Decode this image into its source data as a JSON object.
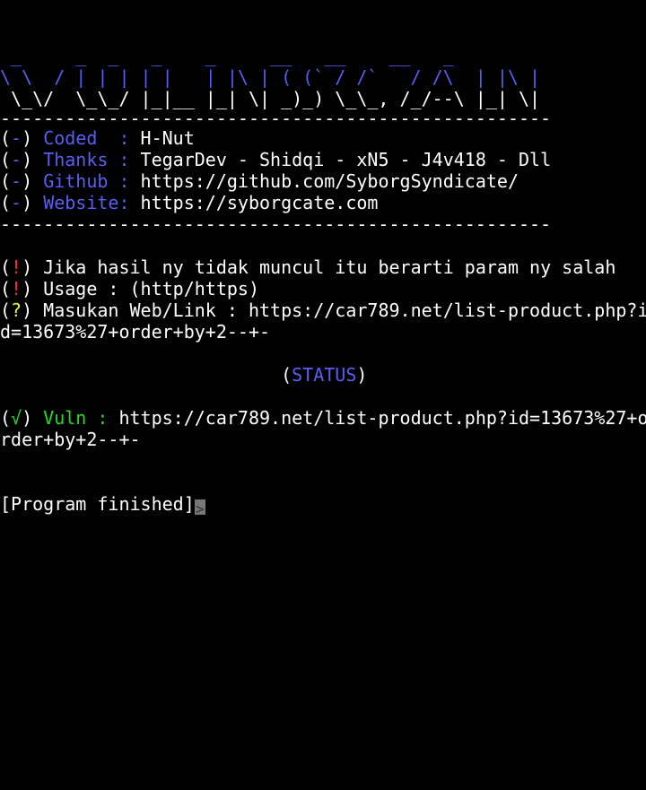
{
  "banner": {
    "lines": [
      " _     _  _   _    _     __   __    __   _  ",
      "\\ \\  / | | | | |   | |\\ | ( (` / /`   / /\\  | |\\ |",
      " \\_\\/  \\_\\_/ |_|__ |_| \\| _)_) \\_\\_, /_/--\\ |_| \\|"
    ],
    "color": "#5a5ef2"
  },
  "separator": "---------------------------------------------------",
  "info": {
    "items": [
      {
        "bullet": "-",
        "label": "Coded  :",
        "value": " H-Nut"
      },
      {
        "bullet": "-",
        "label": "Thanks :",
        "value": " TegarDev - Shidqi - xN5 - J4v418 - Dll"
      },
      {
        "bullet": "-",
        "label": "Github :",
        "value": " https://github.com/SyborgSyndicate/"
      },
      {
        "bullet": "-",
        "label": "Website:",
        "value": " https://syborgcate.com"
      }
    ]
  },
  "messages": {
    "warning_1": {
      "symbol": "!",
      "text": " Jika hasil ny tidak muncul itu berarti param ny salah"
    },
    "warning_2": {
      "symbol": "!",
      "text": " Usage : (http/https)"
    },
    "prompt": {
      "symbol": "?",
      "text": " Masukan Web/Link : https://car789.net/list-product.php?i",
      "wrap": "d=13673%27+order+by+2--+-"
    }
  },
  "status": {
    "indent": "                          ",
    "open": "(",
    "label": "STATUS",
    "close": ")"
  },
  "result": {
    "symbol": "√",
    "label": " Vuln :",
    "value": " https://car789.net/list-product.php?id=13673%27+o",
    "wrap": "rder+by+2--+-"
  },
  "footer": {
    "text": "[Program finished]",
    "cursor": ">"
  },
  "colors": {
    "background": "#000000",
    "text": "#ffffff",
    "accent_blue": "#5a5ef2",
    "warning_red": "#ff2a2a",
    "question_yellow": "#f5f52a",
    "success_green": "#22dd22"
  }
}
